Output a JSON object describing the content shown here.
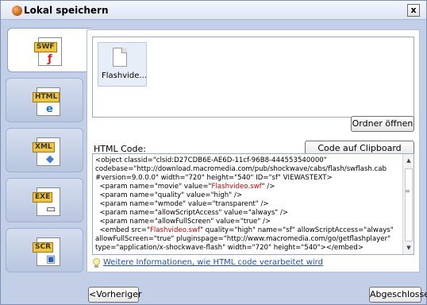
{
  "window": {
    "title": "Lokal speichern",
    "close_label": "x"
  },
  "sidebar": {
    "items": [
      {
        "tag": "SWF",
        "glyph": "ƒ",
        "glyph_color": "#d81b1b",
        "icon": "swf-file-icon",
        "active": true
      },
      {
        "tag": "HTML",
        "glyph": "e",
        "glyph_color": "#1e6fd0",
        "icon": "html-file-icon",
        "active": false
      },
      {
        "tag": "XML",
        "glyph": "◆",
        "glyph_color": "#3d7bd9",
        "icon": "xml-file-icon",
        "active": false
      },
      {
        "tag": "EXE",
        "glyph": "▭",
        "glyph_color": "#333333",
        "icon": "exe-file-icon",
        "active": false
      },
      {
        "tag": "SCR",
        "glyph": "▣",
        "glyph_color": "#2a5fb0",
        "icon": "scr-file-icon",
        "active": false
      }
    ]
  },
  "files": {
    "items": [
      {
        "name": "Flashvide..."
      }
    ],
    "open_folder_label": "Ordner öffnen"
  },
  "code": {
    "label": "HTML Code:",
    "copy_label": "Code auf Clipboard kopieren",
    "lines": [
      [
        {
          "t": "<object classid=\"clsid:D27CDB6E-AE6D-11cf-96B8-444553540000\""
        }
      ],
      [
        {
          "t": "codebase=\"http://download.macromedia.com/pub/shockwave/cabs/flash/swflash.cab"
        }
      ],
      [
        {
          "t": "#version=9.0.0.0\" width=\"720\" height=\"540\" ID=\"sf\" VIEWASTEXT>"
        }
      ],
      [
        {
          "t": "  <param name=\"movie\" value=\""
        },
        {
          "t": "Flashvideo.swf",
          "red": true
        },
        {
          "t": "\" />"
        }
      ],
      [
        {
          "t": "  <param name=\"quality\" value=\"high\" />"
        }
      ],
      [
        {
          "t": "  <param name=\"wmode\" value=\"transparent\" />"
        }
      ],
      [
        {
          "t": "  <param name=\"allowScriptAccess\" value=\"always\" />"
        }
      ],
      [
        {
          "t": "  <param name=\"allowFullScreen\" value=\"true\" />"
        }
      ],
      [
        {
          "t": "  <embed src=\""
        },
        {
          "t": "Flashvideo.swf",
          "red": true
        },
        {
          "t": "\" quality=\"high\" name=\"sf\" allowScriptAccess=\"always\""
        }
      ],
      [
        {
          "t": "allowFullScreen=\"true\" pluginspage=\"http://www.macromedia.com/go/getflashplayer\""
        }
      ],
      [
        {
          "t": "type=\"application/x-shockwave-flash\" width=\"720\" height=\"540\"></embed>"
        }
      ]
    ]
  },
  "info": {
    "link_text": "Weitere Informationen, wie HTML code verarbeitet wird"
  },
  "footer": {
    "prev_label": "<Vorheriger",
    "finish_label": "Abgeschlossen"
  }
}
